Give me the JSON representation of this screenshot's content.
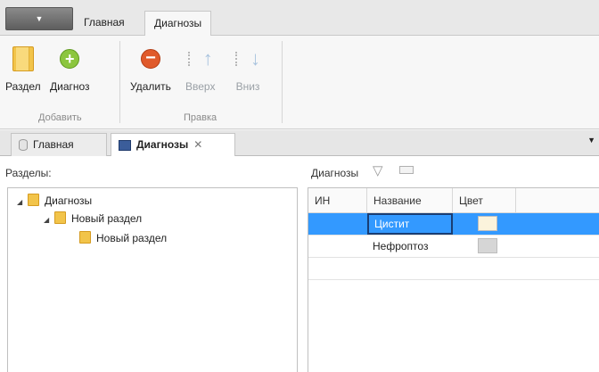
{
  "ribbon": {
    "tabs": [
      "Главная",
      "Диагнозы"
    ],
    "groups": [
      {
        "label": "Добавить",
        "buttons": [
          {
            "label": "Раздел",
            "icon": "folder-icon"
          },
          {
            "label": "Диагноз",
            "icon": "plus-circle-icon"
          }
        ]
      },
      {
        "label": "Правка",
        "buttons": [
          {
            "label": "Удалить",
            "icon": "minus-circle-icon"
          },
          {
            "label": "Вверх",
            "icon": "arrow-up-icon",
            "enabled": false
          },
          {
            "label": "Вниз",
            "icon": "arrow-down-icon",
            "enabled": false
          }
        ]
      }
    ]
  },
  "doc_tabs": [
    {
      "label": "Главная",
      "icon": "database-icon"
    },
    {
      "label": "Диагнозы",
      "icon": "grid-icon",
      "active": true
    }
  ],
  "left": {
    "label": "Разделы:",
    "tree": [
      {
        "label": "Диагнозы",
        "level": 0
      },
      {
        "label": "Новый раздел",
        "level": 1
      },
      {
        "label": "Новый раздел",
        "level": 2
      }
    ]
  },
  "right": {
    "label": "Диагнозы",
    "columns": [
      "ИН",
      "Название",
      "Цвет"
    ],
    "rows": [
      {
        "id": "",
        "name": "Цистит",
        "color": "#fbf3dc",
        "selected": true
      },
      {
        "id": "",
        "name": "Нефроптоз",
        "color": "#d6d6d6"
      }
    ]
  },
  "colors": {
    "selection": "#3399ff",
    "folder": "#f2c44a"
  }
}
